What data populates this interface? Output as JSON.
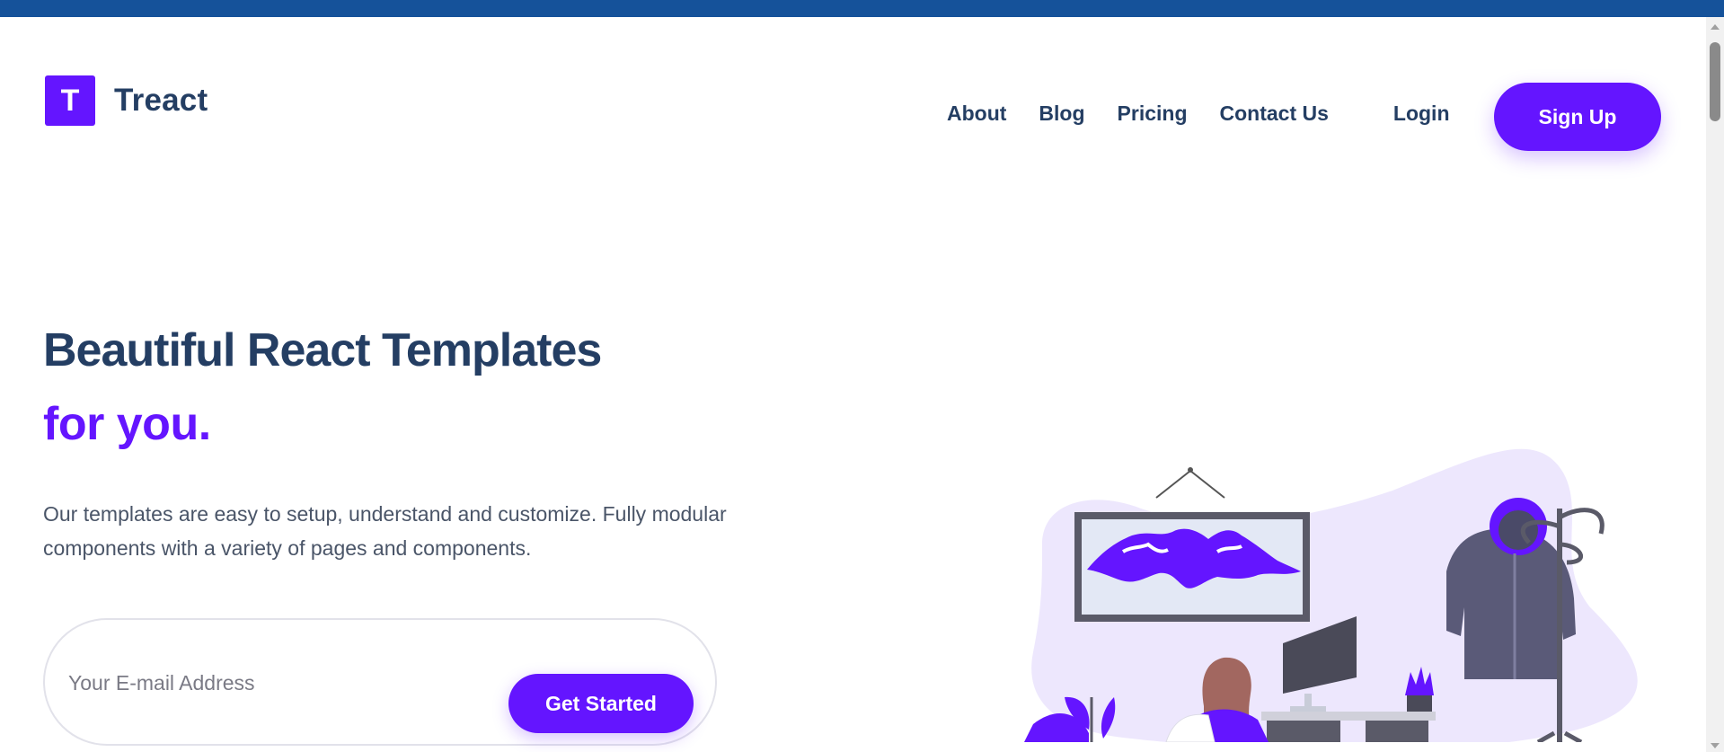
{
  "header": {
    "logo_letter": "T",
    "brand_name": "Treact",
    "nav_items": [
      "About",
      "Blog",
      "Pricing",
      "Contact Us"
    ],
    "login_label": "Login",
    "signup_label": "Sign Up"
  },
  "hero": {
    "title": "Beautiful React Templates",
    "title_accent": "for you.",
    "description": "Our templates are easy to setup, understand and customize. Fully modular components with a variety of pages and components.",
    "email_placeholder": "Your E-mail Address",
    "cta_label": "Get Started"
  },
  "illustration": {
    "icon": "office-workspace-illustration"
  },
  "colors": {
    "primary": "#6415ff",
    "heading": "#243e63",
    "top_bar": "#15529a",
    "body_text": "#4a5568"
  }
}
